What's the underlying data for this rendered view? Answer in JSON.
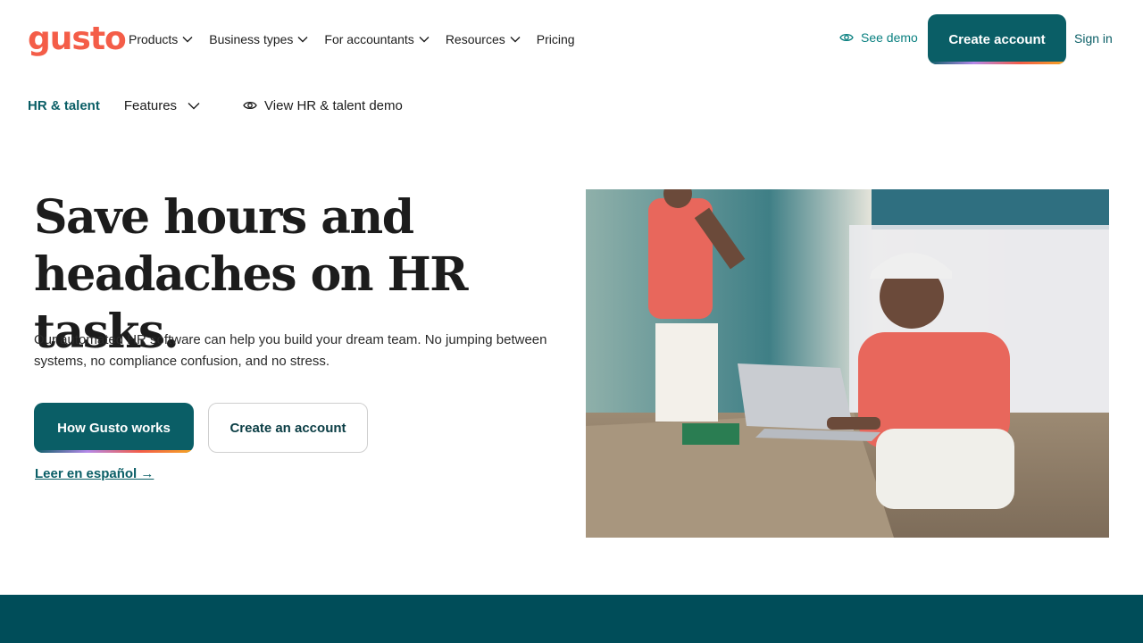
{
  "nav": {
    "logo": "gusto",
    "items": [
      {
        "label": "Products",
        "has_dropdown": true
      },
      {
        "label": "Business types",
        "has_dropdown": true
      },
      {
        "label": "For accountants",
        "has_dropdown": true
      },
      {
        "label": "Resources",
        "has_dropdown": true
      },
      {
        "label": "Pricing",
        "has_dropdown": false
      }
    ],
    "see_demo": "See demo",
    "create_account": "Create account",
    "sign_in": "Sign in"
  },
  "subnav": {
    "section": "HR & talent",
    "features": "Features",
    "demo": "View HR & talent demo"
  },
  "hero": {
    "headline_line1": "Save hours and",
    "headline_line2": "headaches on HR tasks.",
    "subtext": "Our automated HR software can help you build your dream team. No jumping between systems, no compliance confusion, and no stress.",
    "primary_button": "How Gusto works",
    "secondary_button": "Create an account",
    "spanish_link": "Leer en español →"
  },
  "colors": {
    "brand": "#f45d48",
    "primary": "#0a5e66",
    "band": "#004d59"
  }
}
